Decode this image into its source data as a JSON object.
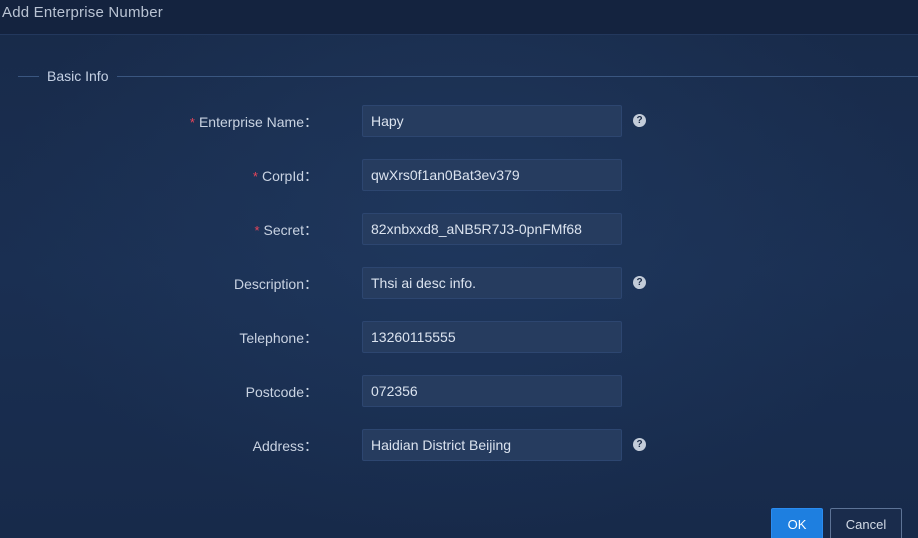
{
  "dialog": {
    "title": "Add Enterprise Number"
  },
  "section": {
    "legend": "Basic Info"
  },
  "fields": [
    {
      "label": "Enterprise Name",
      "separator": "：",
      "required": true,
      "value": "Hapy",
      "help": true
    },
    {
      "label": "CorpId",
      "separator": "：",
      "required": true,
      "value": "qwXrs0f1an0Bat3ev379",
      "help": false
    },
    {
      "label": "Secret",
      "separator": "：",
      "required": true,
      "value": "82xnbxxd8_aNB5R7J3-0pnFMf68",
      "help": false
    },
    {
      "label": "Description",
      "separator": "：",
      "required": false,
      "value": "Thsi ai desc info.",
      "help": true
    },
    {
      "label": "Telephone",
      "separator": "：",
      "required": false,
      "value": "13260115555",
      "help": false
    },
    {
      "label": "Postcode",
      "separator": "：",
      "required": false,
      "value": "072356",
      "help": false
    },
    {
      "label": "Address",
      "separator": "：",
      "required": false,
      "value": "Haidian District Beijing",
      "help": true
    }
  ],
  "required_mark": "*",
  "help_icon": "?",
  "buttons": {
    "ok_label": "OK",
    "cancel_label": "Cancel"
  },
  "colors": {
    "background": "#1b2b47",
    "input_bg": "#263c5f",
    "required": "#e8455a",
    "primary": "#1e7fe0"
  }
}
